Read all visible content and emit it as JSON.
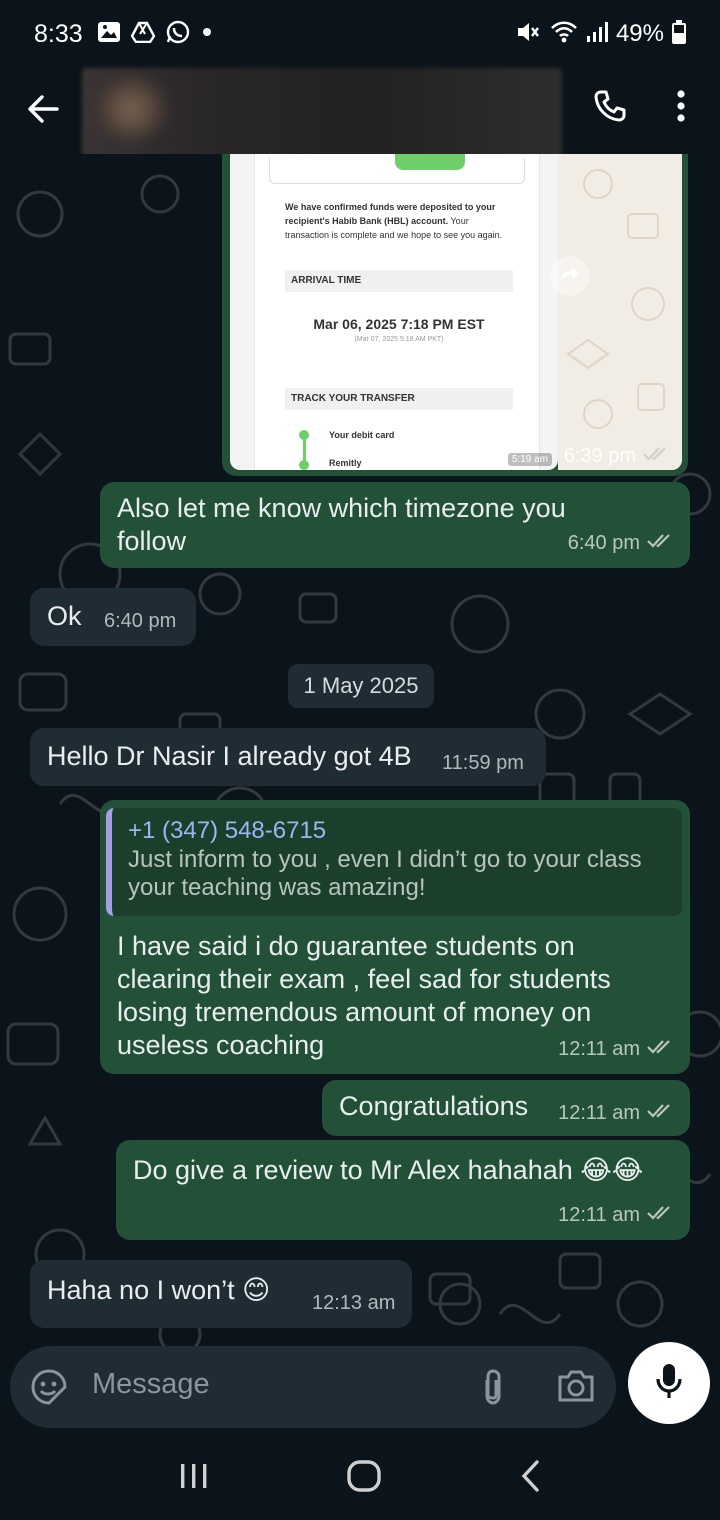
{
  "status_bar": {
    "time": "8:33",
    "battery": "49%",
    "icons": [
      "gallery-icon",
      "drive-icon",
      "whatsapp-icon",
      "dot-icon",
      "mute-icon",
      "wifi-icon",
      "signal-icon",
      "battery-icon"
    ]
  },
  "header": {
    "back_icon": "arrow-left-icon",
    "call_icon": "phone-icon",
    "menu_icon": "more-vertical-icon"
  },
  "messages": {
    "image_message": {
      "screenshot": {
        "paragraph_bold": "We have confirmed funds were deposited to your recipient's Habib Bank (HBL) account.",
        "paragraph_rest": " Your transaction is complete and we hope to see you again.",
        "arrival_label": "ARRIVAL TIME",
        "arrival_time": "Mar 06, 2025 7:18 PM EST",
        "arrival_sub": "(Mar 07, 2025 5:18 AM PKT)",
        "track_label": "TRACK YOUR TRANSFER",
        "step1": "Your debit card",
        "step2": "Remitly",
        "inner_time": "5:19 am"
      },
      "time": "6:39 pm"
    },
    "m1": {
      "text": "Also let me know which  timezone you follow",
      "time": "6:40 pm"
    },
    "m2": {
      "text": "Ok",
      "time": "6:40 pm"
    },
    "date_divider": "1 May 2025",
    "m3": {
      "text": "Hello Dr Nasir I already got 4B",
      "time": "11:59 pm"
    },
    "m4": {
      "quote_name": "+1 (347) 548-6715",
      "quote_line1": "Just inform to you , even I didn’t go to your class",
      "quote_line2": "your teaching was amazing!",
      "text": "I have said i do guarantee students on clearing their exam , feel sad for students losing tremendous amount of money on useless coaching",
      "time": "12:11 am"
    },
    "m5": {
      "text": "Congratulations",
      "time": "12:11 am"
    },
    "m6": {
      "text": "Do give a review to Mr Alex hahahah 😂😂",
      "time": "12:11 am"
    },
    "m7": {
      "text": "Haha no I won’t 😊",
      "time": "12:13 am"
    }
  },
  "input": {
    "placeholder": "Message",
    "emoji_icon": "sticker-icon",
    "attach_icon": "paperclip-icon",
    "camera_icon": "camera-icon",
    "mic_icon": "mic-icon"
  },
  "nav": {
    "icons": [
      "recent-apps-icon",
      "home-icon",
      "back-icon"
    ]
  },
  "colors": {
    "background": "#0b141a",
    "outgoing_bubble": "#225137",
    "incoming_bubble": "#202c33",
    "read_ticks": "#b9c6bf"
  }
}
